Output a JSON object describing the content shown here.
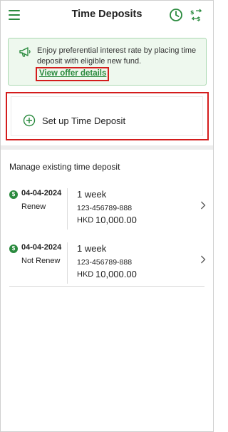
{
  "header": {
    "title": "Time Deposits",
    "menu_icon": "hamburger-menu-icon",
    "history_icon": "clock-icon",
    "fx_icon": "currency-exchange-icon"
  },
  "banner": {
    "icon": "megaphone-icon",
    "text": "Enjoy preferential interest rate by placing time deposit with eligible new fund.",
    "link_label": "View offer details"
  },
  "setup": {
    "icon": "plus-circle-icon",
    "label": "Set up Time Deposit"
  },
  "manage": {
    "title": "Manage existing time deposit",
    "deposits": [
      {
        "date": "04-04-2024",
        "renewal": "Renew",
        "tenor": "1 week",
        "account": "123-456789-888",
        "currency": "HKD",
        "amount": "10,000.00"
      },
      {
        "date": "04-04-2024",
        "renewal": "Not Renew",
        "tenor": "1 week",
        "account": "123-456789-888",
        "currency": "HKD",
        "amount": "10,000.00"
      }
    ]
  },
  "colors": {
    "brand_green": "#2a8a3e",
    "highlight_red": "#d41c1c",
    "banner_bg": "#eef8ee"
  }
}
